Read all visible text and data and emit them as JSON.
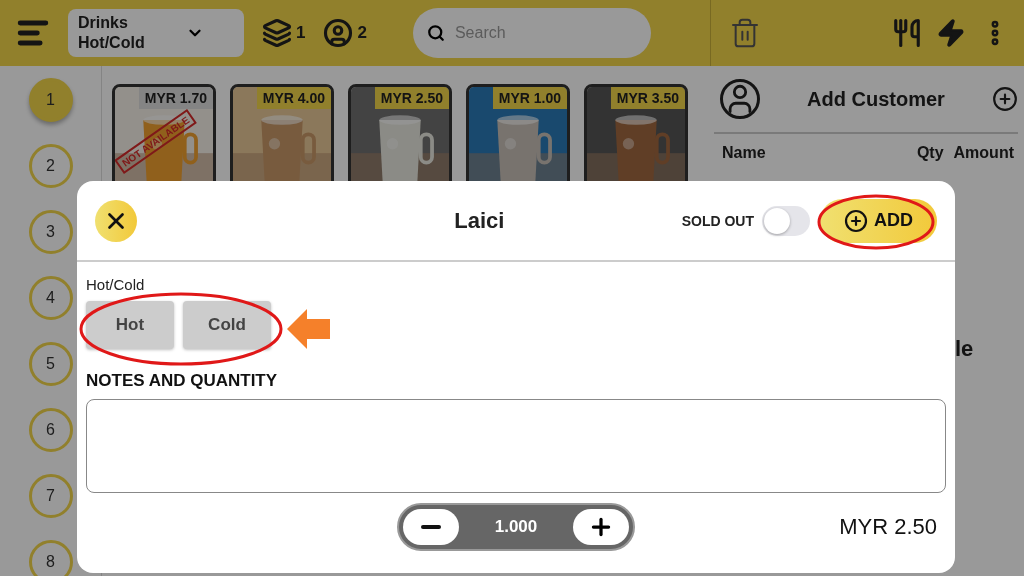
{
  "top_bar": {
    "category": "Drinks Hot/Cold",
    "layers_count": "1",
    "guests_count": "2",
    "search": {
      "placeholder": "Search"
    }
  },
  "tables": [
    {
      "label": "1",
      "selected": true
    },
    {
      "label": "2",
      "selected": false
    },
    {
      "label": "3",
      "selected": false
    },
    {
      "label": "4",
      "selected": false
    },
    {
      "label": "5",
      "selected": false
    },
    {
      "label": "6",
      "selected": false
    },
    {
      "label": "7",
      "selected": false
    },
    {
      "label": "8",
      "selected": false
    }
  ],
  "products": [
    {
      "price": "MYR 1.70",
      "available": false,
      "stamp": "NOT AVAILABLE",
      "kind": "picture"
    },
    {
      "price": "MYR 4.00",
      "available": true,
      "kind": "picture"
    },
    {
      "price": "MYR 2.50",
      "available": true,
      "kind": "picture"
    },
    {
      "price": "MYR 1.00",
      "available": true,
      "kind": "picture"
    },
    {
      "price": "MYR 3.50",
      "available": true,
      "kind": "picture"
    }
  ],
  "order_panel": {
    "title": "Add Customer",
    "columns": [
      "Name",
      "Qty",
      "Amount"
    ],
    "partial_text": "le"
  },
  "dialog": {
    "title": "Laici",
    "sold_out": {
      "label": "SOLD OUT",
      "on": false
    },
    "add_button": "ADD",
    "option_group": {
      "label": "Hot/Cold",
      "options": [
        {
          "label": "Hot",
          "selected": false
        },
        {
          "label": "Cold",
          "selected": false
        }
      ]
    },
    "notes_label": "NOTES AND QUANTITY",
    "quantity": "1.000",
    "price": "MYR 2.50"
  }
}
